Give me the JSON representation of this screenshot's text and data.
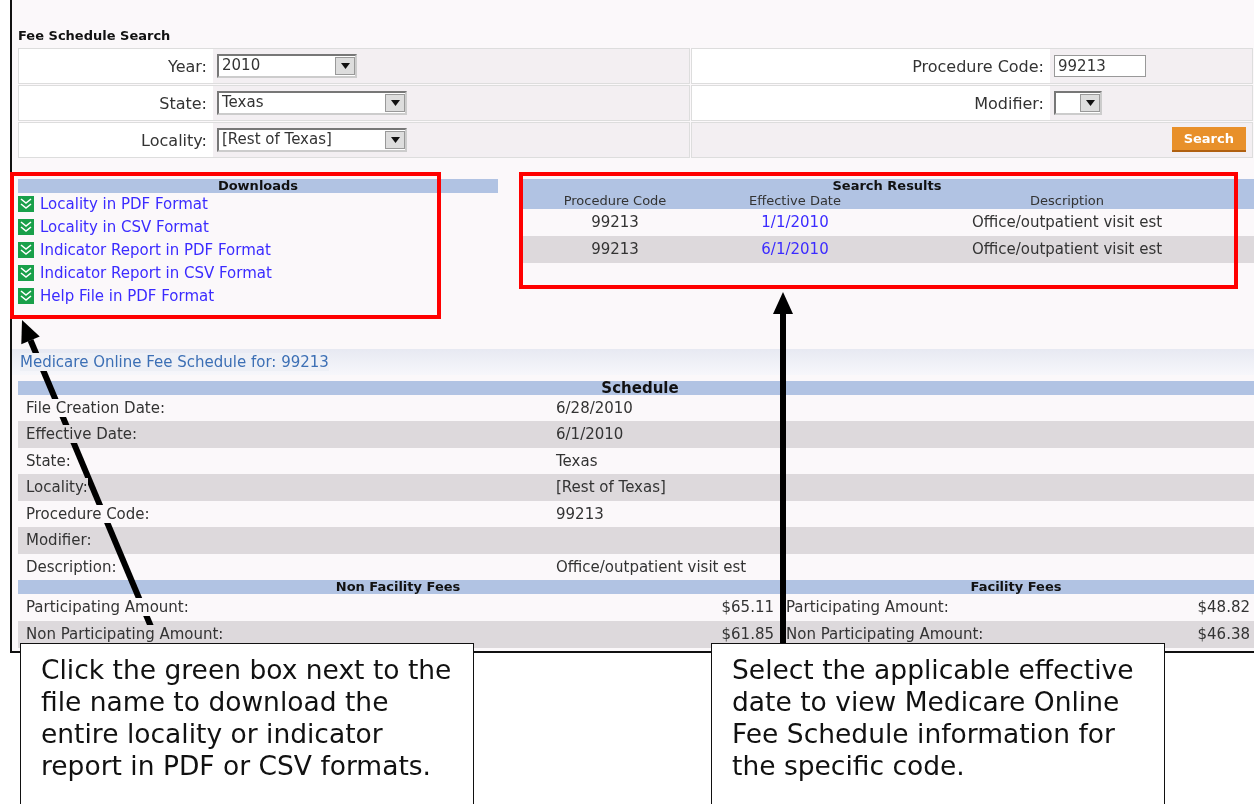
{
  "search_form": {
    "title": "Fee Schedule Search",
    "left_fields": [
      {
        "label": "Year:",
        "value": "2010",
        "kind": "select"
      },
      {
        "label": "State:",
        "value": "Texas",
        "kind": "select"
      },
      {
        "label": "Locality:",
        "value": "[Rest of Texas]",
        "kind": "select"
      }
    ],
    "right_fields": [
      {
        "label": "Procedure Code:",
        "value": "99213",
        "kind": "text"
      },
      {
        "label": "Modifier:",
        "kind": "select"
      }
    ],
    "search_button": "Search"
  },
  "downloads": {
    "title": "Downloads",
    "items": [
      {
        "label": "Locality in PDF Format"
      },
      {
        "label": "Locality in CSV Format"
      },
      {
        "label": "Indicator Report in PDF Format"
      },
      {
        "label": "Indicator Report in CSV Format"
      },
      {
        "label": "Help File in PDF Format"
      }
    ]
  },
  "search_results": {
    "title": "Search Results",
    "columns": [
      "Procedure Code",
      "Effective Date",
      "Description"
    ],
    "rows": [
      {
        "code": "99213",
        "date": "1/1/2010",
        "description": "Office/outpatient visit est"
      },
      {
        "code": "99213",
        "date": "6/1/2010",
        "description": "Office/outpatient visit est"
      }
    ]
  },
  "fee_schedule": {
    "heading": "Medicare Online Fee Schedule for: 99213",
    "schedule_title": "Schedule",
    "rows": [
      {
        "label": "File Creation Date:",
        "value": "6/28/2010"
      },
      {
        "label": "Effective Date:",
        "value": "6/1/2010"
      },
      {
        "label": "State:",
        "value": "Texas"
      },
      {
        "label": "Locality:",
        "value": "[Rest of Texas]"
      },
      {
        "label": "Procedure Code:",
        "value": "99213"
      },
      {
        "label": "Modifier:"
      },
      {
        "label": "Description:",
        "value": "Office/outpatient visit est"
      }
    ],
    "fee_groups": [
      {
        "title": "Non Facility Fees",
        "rows": [
          {
            "label": "Participating Amount:",
            "value": "$65.11"
          },
          {
            "label": "Non Participating Amount:",
            "value": "$61.85"
          }
        ]
      },
      {
        "title": "Facility Fees",
        "rows": [
          {
            "label": "Participating Amount:",
            "value": "$48.82"
          },
          {
            "label": "Non Participating Amount:",
            "value": "$46.38"
          }
        ]
      }
    ]
  },
  "callouts": [
    {
      "text": "Click the green box next to the file name to download the entire locality or indicator report in PDF or CSV formats."
    },
    {
      "text": "Select the applicable effective date to view Medicare Online Fee Schedule information for the specific code."
    }
  ]
}
